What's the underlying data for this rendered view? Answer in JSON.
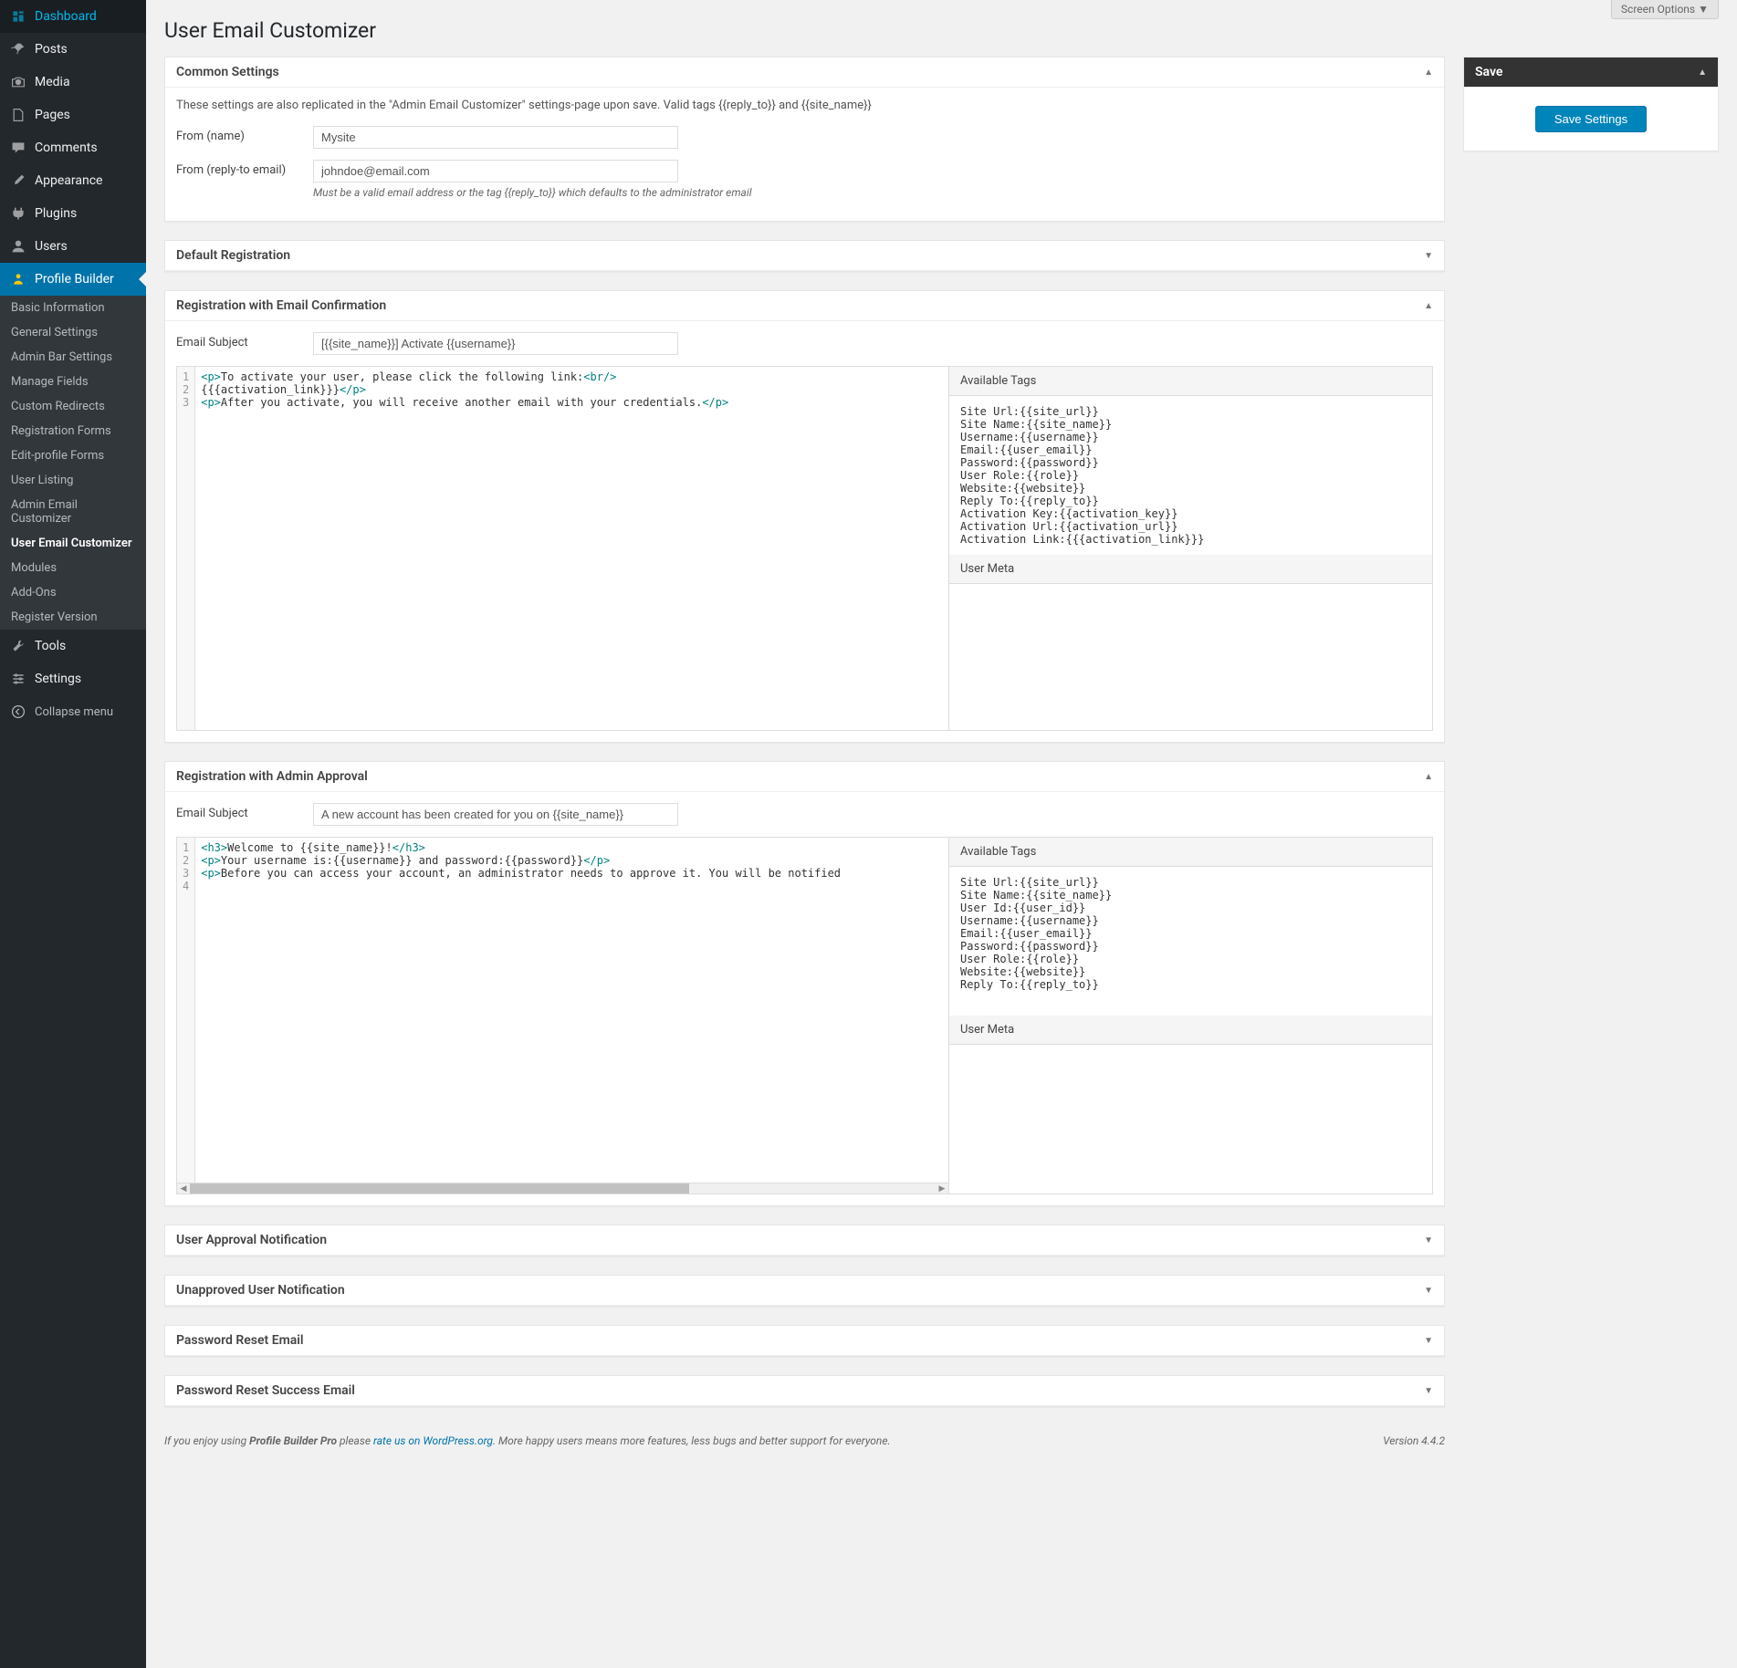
{
  "screen_options": "Screen Options",
  "page_title": "User Email Customizer",
  "sidebar": {
    "items": [
      {
        "label": "Dashboard"
      },
      {
        "label": "Posts"
      },
      {
        "label": "Media"
      },
      {
        "label": "Pages"
      },
      {
        "label": "Comments"
      },
      {
        "label": "Appearance"
      },
      {
        "label": "Plugins"
      },
      {
        "label": "Users"
      },
      {
        "label": "Profile Builder"
      },
      {
        "label": "Tools"
      },
      {
        "label": "Settings"
      }
    ],
    "collapse": "Collapse menu",
    "submenu": [
      "Basic Information",
      "General Settings",
      "Admin Bar Settings",
      "Manage Fields",
      "Custom Redirects",
      "Registration Forms",
      "Edit-profile Forms",
      "User Listing",
      "Admin Email Customizer",
      "User Email Customizer",
      "Modules",
      "Add-Ons",
      "Register Version"
    ]
  },
  "common": {
    "title": "Common Settings",
    "desc": "These settings are also replicated in the \"Admin Email Customizer\" settings-page upon save. Valid tags {{reply_to}} and {{site_name}}",
    "from_name_label": "From (name)",
    "from_name_value": "Mysite",
    "from_email_label": "From (reply-to email)",
    "from_email_value": "johndoe@email.com",
    "from_email_help": "Must be a valid email address or the tag {{reply_to}} which defaults to the administrator email"
  },
  "default_reg": {
    "title": "Default Registration"
  },
  "email_conf": {
    "title": "Registration with Email Confirmation",
    "subject_label": "Email Subject",
    "subject_value": "[{{site_name}}] Activate {{username}}",
    "code_lines": [
      {
        "n": 1,
        "html": "<span class='tag'>&lt;p&gt;</span><span class='text'>To activate your user, please click the following link:</span><span class='tag'>&lt;br/&gt;</span>"
      },
      {
        "n": 2,
        "html": "<span class='text'>{{{activation_link}}}</span><span class='tag'>&lt;/p&gt;</span>"
      },
      {
        "n": 3,
        "html": "<span class='tag'>&lt;p&gt;</span><span class='text'>After you activate, you will receive another email with your credentials.</span><span class='tag'>&lt;/p&gt;</span>"
      }
    ],
    "tags_header": "Available Tags",
    "tags": "Site Url:{{site_url}}\nSite Name:{{site_name}}\nUsername:{{username}}\nEmail:{{user_email}}\nPassword:{{password}}\nUser Role:{{role}}\nWebsite:{{website}}\nReply To:{{reply_to}}\nActivation Key:{{activation_key}}\nActivation Url:{{activation_url}}\nActivation Link:{{{activation_link}}}",
    "usermeta_header": "User Meta"
  },
  "admin_approval": {
    "title": "Registration with Admin Approval",
    "subject_label": "Email Subject",
    "subject_value": "A new account has been created for you on {{site_name}}",
    "code_lines": [
      {
        "n": 1,
        "html": "<span class='tag'>&lt;h3&gt;</span><span class='text'>Welcome to {{site_name}}!</span><span class='tag'>&lt;/h3&gt;</span>"
      },
      {
        "n": 2,
        "html": "<span class='tag'>&lt;p&gt;</span><span class='text'>Your username is:{{username}} and password:{{password}}</span><span class='tag'>&lt;/p&gt;</span>"
      },
      {
        "n": 3,
        "html": "<span class='tag'>&lt;p&gt;</span><span class='text'>Before you can access your account, an administrator needs to approve it. You will be notified</span>"
      },
      {
        "n": 4,
        "html": ""
      }
    ],
    "tags_header": "Available Tags",
    "tags": "Site Url:{{site_url}}\nSite Name:{{site_name}}\nUser Id:{{user_id}}\nUsername:{{username}}\nEmail:{{user_email}}\nPassword:{{password}}\nUser Role:{{role}}\nWebsite:{{website}}\nReply To:{{reply_to}}",
    "usermeta_header": "User Meta"
  },
  "closed_boxes": [
    "User Approval Notification",
    "Unapproved User Notification",
    "Password Reset Email",
    "Password Reset Success Email"
  ],
  "save": {
    "title": "Save",
    "button": "Save Settings"
  },
  "footer": {
    "prefix": "If you enjoy using ",
    "product": "Profile Builder Pro",
    "mid": " please ",
    "link": "rate us on WordPress.org",
    "suffix": ". More happy users means more features, less bugs and better support for everyone.",
    "version": "Version 4.4.2"
  }
}
